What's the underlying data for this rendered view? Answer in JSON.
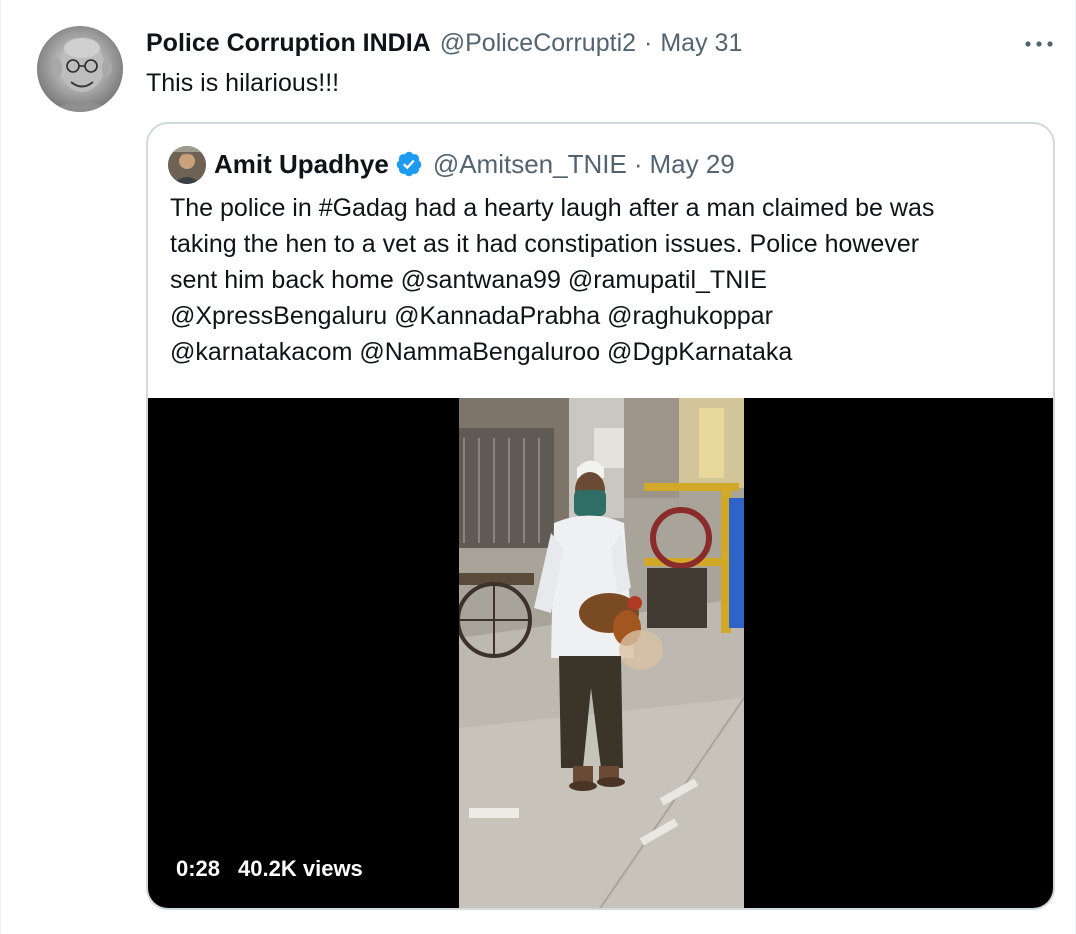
{
  "tweet": {
    "display_name": "Police Corruption INDIA",
    "handle": "@PoliceCorrupti2",
    "separator": "·",
    "date": "May 31",
    "text": "This is hilarious!!!",
    "more_icon": "more-horizontal-icon"
  },
  "quoted_tweet": {
    "display_name": "Amit Upadhye",
    "verified": true,
    "verified_icon": "verified-badge-icon",
    "handle": "@Amitsen_TNIE",
    "separator": "·",
    "date": "May 29",
    "text_lines": [
      "The police in #Gadag had a hearty laugh after a man claimed be was",
      "taking the hen to a vet as it had constipation issues. Police however",
      "sent him back home @santwana99 @ramupatil_TNIE",
      "@XpressBengaluru @KannadaPrabha @raghukoppar",
      "@karnatakacom @NammaBengaluroo @DgpKarnataka"
    ],
    "video": {
      "duration": "0:28",
      "views": "40.2K views"
    }
  },
  "colors": {
    "text_primary": "#0f1419",
    "text_secondary": "#536471",
    "border": "#cfd9de",
    "verified_blue": "#1d9bf0",
    "media_background": "#000000"
  }
}
